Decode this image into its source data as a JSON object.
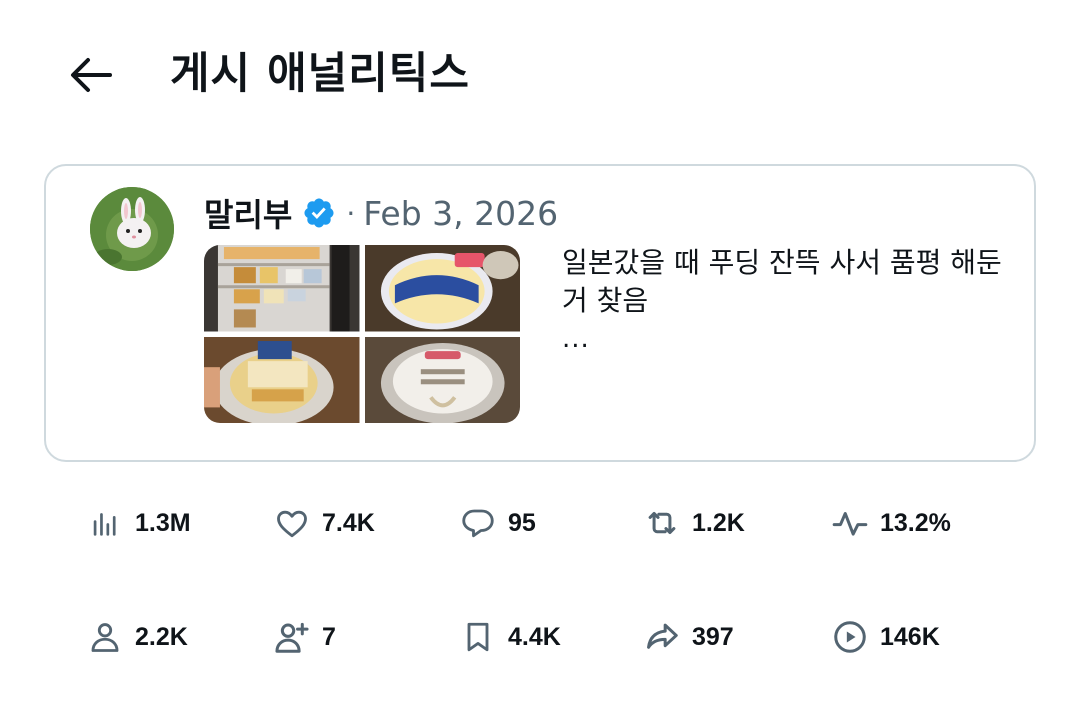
{
  "header": {
    "title": "게시 애널리틱스"
  },
  "post": {
    "author": "말리부",
    "date": "Feb 3, 2026",
    "text": "일본갔을 때 푸딩 잔뜩 사서 품평 해둔 거 찾음",
    "more": "...",
    "verified": true,
    "verified_color": "#1d9bf0"
  },
  "metrics": {
    "row1": [
      {
        "icon": "bar-chart-icon",
        "value": "1.3M"
      },
      {
        "icon": "heart-icon",
        "value": "7.4K"
      },
      {
        "icon": "reply-icon",
        "value": "95"
      },
      {
        "icon": "repost-icon",
        "value": "1.2K"
      },
      {
        "icon": "activity-icon",
        "value": "13.2%"
      }
    ],
    "row2": [
      {
        "icon": "person-icon",
        "value": "2.2K"
      },
      {
        "icon": "person-add-icon",
        "value": "7"
      },
      {
        "icon": "bookmark-icon",
        "value": "4.4K"
      },
      {
        "icon": "share-icon",
        "value": "397"
      },
      {
        "icon": "play-icon",
        "value": "146K"
      }
    ]
  },
  "colors": {
    "text": "#0f1419",
    "secondary": "#536471",
    "border": "#cfd9de",
    "icon": "#536471"
  }
}
